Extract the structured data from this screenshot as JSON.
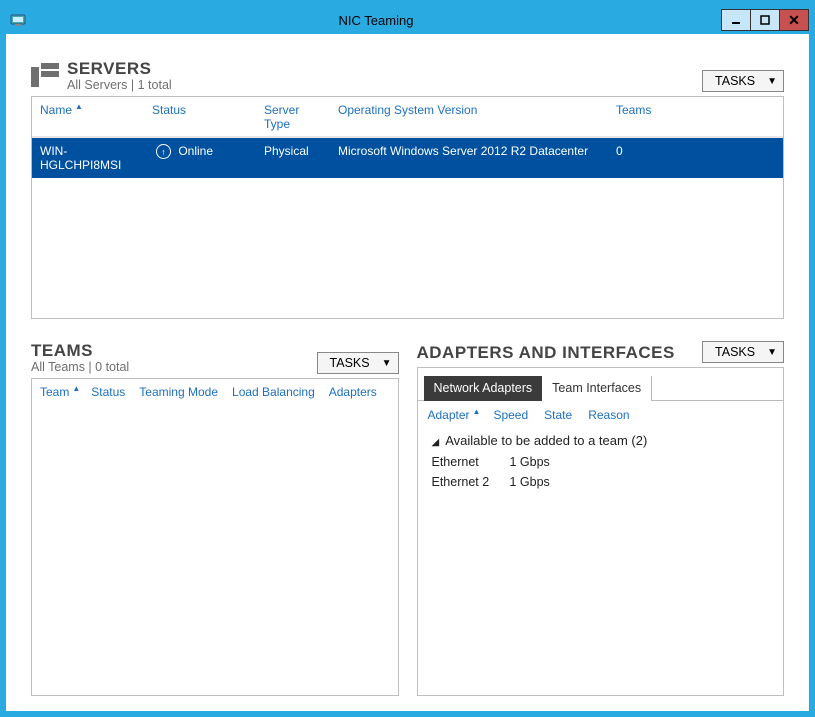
{
  "window": {
    "title": "NIC Teaming"
  },
  "tasks_label": "TASKS",
  "servers": {
    "heading": "SERVERS",
    "sub": "All Servers | 1 total",
    "columns": {
      "name": "Name",
      "status": "Status",
      "type": "Server Type",
      "os": "Operating System Version",
      "teams": "Teams"
    },
    "rows": [
      {
        "name": "WIN-HGLCHPI8MSI",
        "status": "Online",
        "type": "Physical",
        "os": "Microsoft Windows Server 2012 R2 Datacenter",
        "teams": "0"
      }
    ]
  },
  "teams": {
    "heading": "TEAMS",
    "sub": "All Teams | 0 total",
    "columns": {
      "team": "Team",
      "status": "Status",
      "mode": "Teaming Mode",
      "lb": "Load Balancing",
      "adapters": "Adapters"
    }
  },
  "adapters": {
    "heading": "ADAPTERS AND INTERFACES",
    "tabs": {
      "na": "Network Adapters",
      "ti": "Team Interfaces"
    },
    "columns": {
      "adapter": "Adapter",
      "speed": "Speed",
      "state": "State",
      "reason": "Reason"
    },
    "group_label": "Available to be added to a team (2)",
    "rows": [
      {
        "adapter": "Ethernet",
        "speed": "1 Gbps"
      },
      {
        "adapter": "Ethernet 2",
        "speed": "1 Gbps"
      }
    ]
  }
}
